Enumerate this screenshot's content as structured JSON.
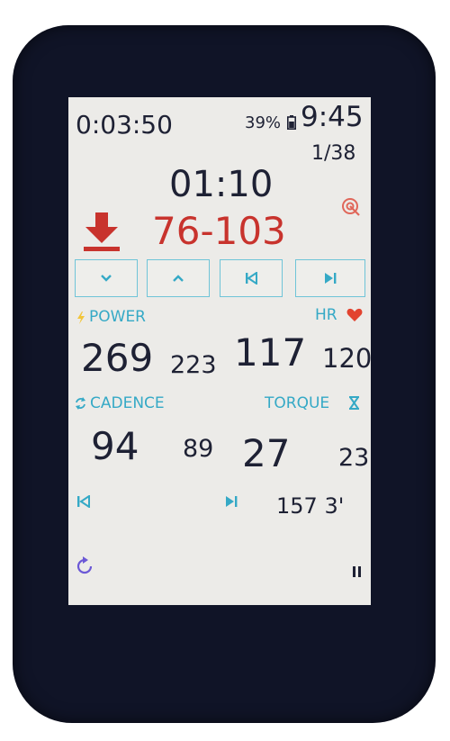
{
  "status": {
    "elapsed": "0:03:50",
    "battery": "39%",
    "clock": "9:45",
    "step": "1/38"
  },
  "interval": {
    "remaining": "01:10",
    "target_range": "76-103"
  },
  "controls": [
    "prev-down",
    "next-up",
    "skip-back",
    "skip-forward"
  ],
  "metrics": {
    "power": {
      "label": "POWER",
      "current": "269",
      "average": "223"
    },
    "hr": {
      "label": "HR",
      "current": "117",
      "average": "120"
    },
    "cadence": {
      "label": "CADENCE",
      "current": "94",
      "average": "89"
    },
    "torque": {
      "label": "TORQUE",
      "current": "27",
      "average": "23"
    }
  },
  "lap": {
    "value": "157 3'"
  },
  "colors": {
    "accent": "#35a9c6",
    "target": "#c8332d",
    "heart": "#e2432f",
    "bezel": "#101427",
    "screen": "#ecebe8"
  },
  "icons": [
    "battery-icon",
    "download-arrow-icon",
    "target-icon",
    "lightning-icon",
    "heart-icon",
    "cycle-icon",
    "hourglass-icon",
    "skip-back-icon",
    "skip-forward-icon",
    "refresh-icon",
    "pause-icon"
  ]
}
